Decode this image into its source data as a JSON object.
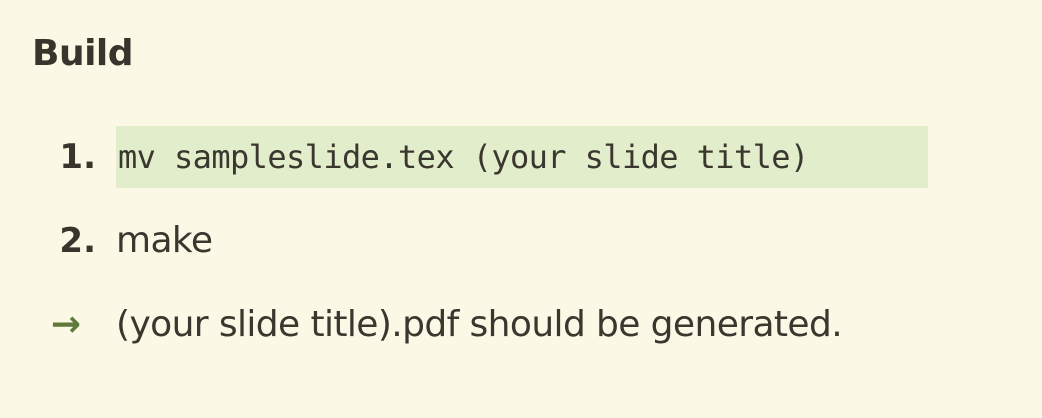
{
  "section": {
    "title": "Build"
  },
  "steps": [
    {
      "marker": "1.",
      "text": "mv sampleslide.tex (your slide title)"
    },
    {
      "marker": "2.",
      "text": "make"
    }
  ],
  "result": {
    "marker": "→",
    "text": "(your slide title).pdf should be generated.",
    "marker_color": "#5f7a3a"
  },
  "colors": {
    "background": "#fcf8e6",
    "code_highlight": "#e2eecb",
    "text": "#3a372e"
  }
}
